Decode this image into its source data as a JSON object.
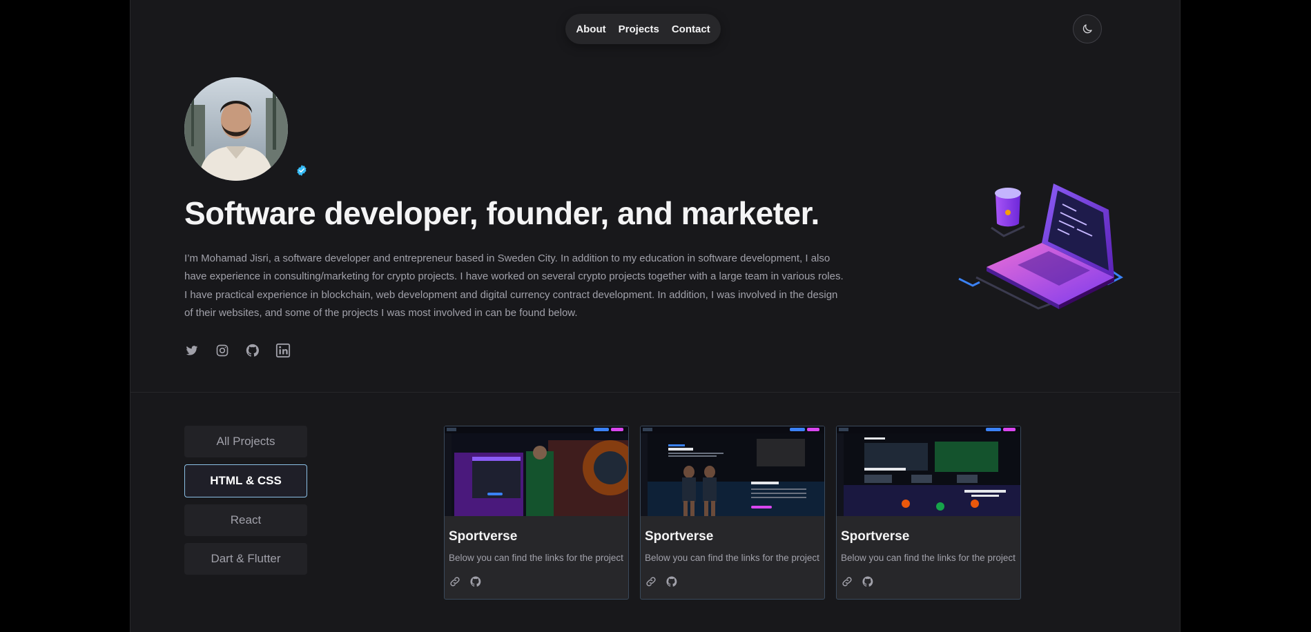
{
  "nav": {
    "items": [
      {
        "label": "About"
      },
      {
        "label": "Projects"
      },
      {
        "label": "Contact"
      }
    ]
  },
  "hero": {
    "headline": "Software developer, founder, and marketer.",
    "bio": "I’m Mohamad Jisri, a software developer and entrepreneur based in Sweden City. In addition to my education in software development, I also have experience in consulting/marketing for crypto projects. I have worked on several crypto projects together with a large team in various roles. I have practical experience in blockchain, web development and digital currency contract development. In addition, I was involved in the design of their websites, and some of the projects I was most involved in can be found below.",
    "socials": [
      "twitter-icon",
      "instagram-icon",
      "github-icon",
      "linkedin-icon"
    ]
  },
  "filters": {
    "items": [
      {
        "label": "All Projects",
        "active": false
      },
      {
        "label": "HTML & CSS",
        "active": true
      },
      {
        "label": "React",
        "active": false
      },
      {
        "label": "Dart & Flutter",
        "active": false
      }
    ]
  },
  "projects": [
    {
      "title": "Sportverse",
      "description": "Below you can find the links for the project"
    },
    {
      "title": "Sportverse",
      "description": "Below you can find the links for the project"
    },
    {
      "title": "Sportverse",
      "description": "Below you can find the links for the project"
    }
  ],
  "colors": {
    "background": "#18181b",
    "accent": "#8cc1e6",
    "verified": "#38bdf8"
  }
}
